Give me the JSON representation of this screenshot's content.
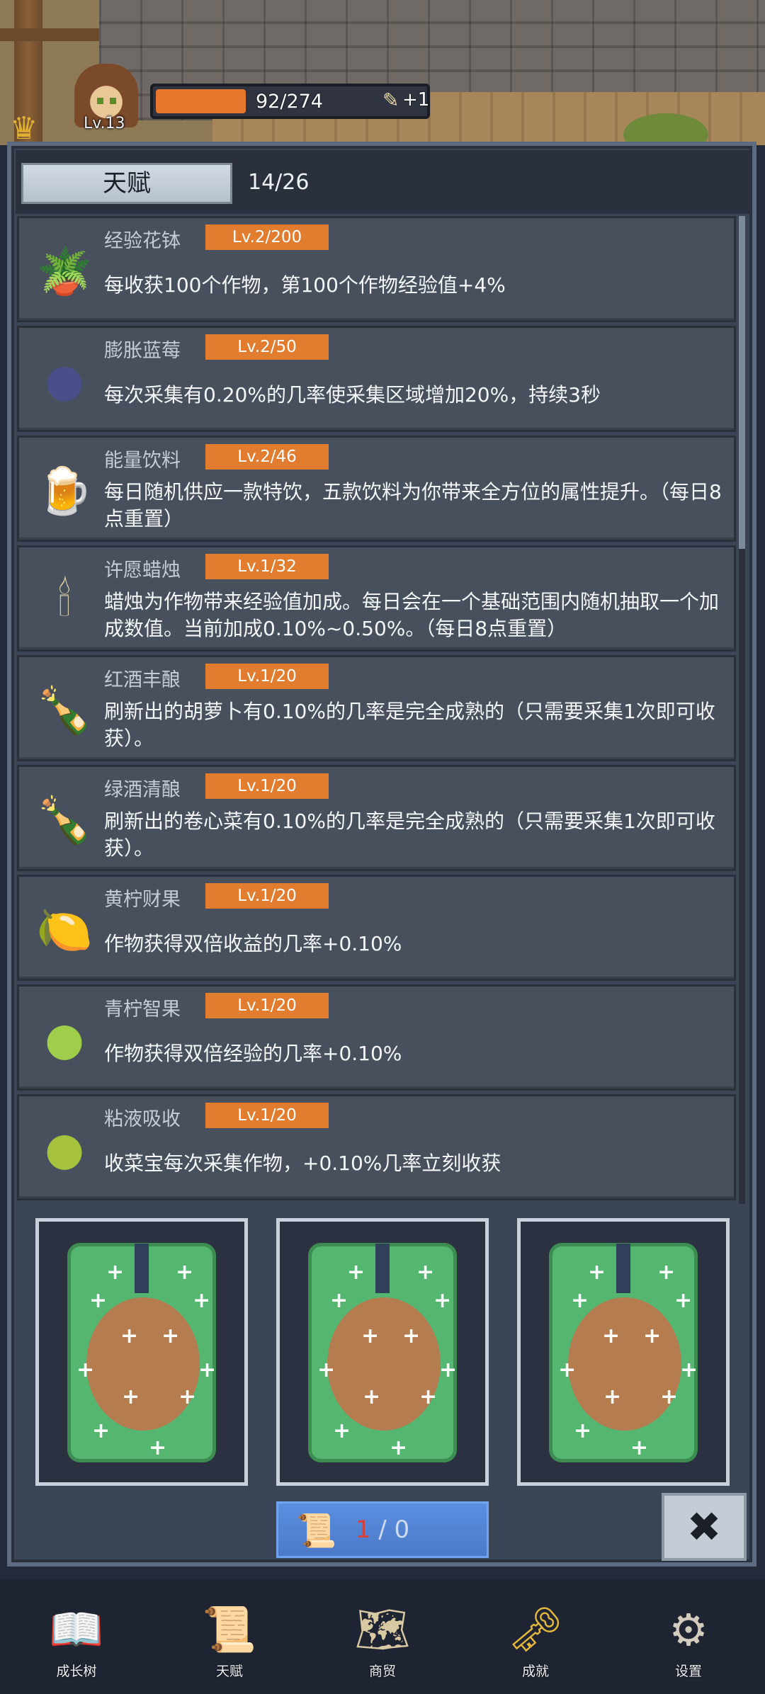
{
  "player": {
    "level": "Lv.13",
    "xp_text": "92/274",
    "xp_fraction": 0.336,
    "scroll_bonus": "+1"
  },
  "talent_panel": {
    "tab_label": "天赋",
    "count": "14/26"
  },
  "talents": [
    {
      "name": "经验花钵",
      "level": "Lv.2/200",
      "desc": "每收获100个作物，第100个作物经验值+4%",
      "icon": "flower-pot-icon"
    },
    {
      "name": "膨胀蓝莓",
      "level": "Lv.2/50",
      "desc": "每次采集有0.20%的几率使采集区域增加20%，持续3秒",
      "icon": "blueberry-icon"
    },
    {
      "name": "能量饮料",
      "level": "Lv.2/46",
      "desc": "每日随机供应一款特饮，五款饮料为你带来全方位的属性提升。（每日8点重置）",
      "icon": "drink-cup-icon"
    },
    {
      "name": "许愿蜡烛",
      "level": "Lv.1/32",
      "desc": "蜡烛为作物带来经验值加成。每日会在一个基础范围内随机抽取一个加成数值。当前加成0.10%~0.50%。（每日8点重置）",
      "icon": "candle-icon"
    },
    {
      "name": "红酒丰酿",
      "level": "Lv.1/20",
      "desc": "刷新出的胡萝卜有0.10%的几率是完全成熟的（只需要采集1次即可收获）。",
      "icon": "red-wine-icon"
    },
    {
      "name": "绿酒清酿",
      "level": "Lv.1/20",
      "desc": "刷新出的卷心菜有0.10%的几率是完全成熟的（只需要采集1次即可收获）。",
      "icon": "green-wine-icon"
    },
    {
      "name": "黄柠财果",
      "level": "Lv.1/20",
      "desc": "作物获得双倍收益的几率+0.10%",
      "icon": "lemon-icon"
    },
    {
      "name": "青柠智果",
      "level": "Lv.1/20",
      "desc": "作物获得双倍经验的几率+0.10%",
      "icon": "lime-icon"
    },
    {
      "name": "粘液吸收",
      "level": "Lv.1/20",
      "desc": "收菜宝每次采集作物，+0.10%几率立刻收获",
      "icon": "slime-icon"
    }
  ],
  "draw": {
    "current": "1",
    "separator": " / ",
    "total": "0"
  },
  "close_symbol": "✖",
  "nav": [
    {
      "label": "成长树",
      "icon": "book-icon"
    },
    {
      "label": "天赋",
      "icon": "scroll-icon"
    },
    {
      "label": "商贸",
      "icon": "map-icon"
    },
    {
      "label": "成就",
      "icon": "key-icon"
    },
    {
      "label": "设置",
      "icon": "gear-icon"
    }
  ],
  "colors": {
    "accent_orange": "#e27d2f",
    "draw_button_blue": "#4b79c8",
    "card_green": "#55b672"
  }
}
